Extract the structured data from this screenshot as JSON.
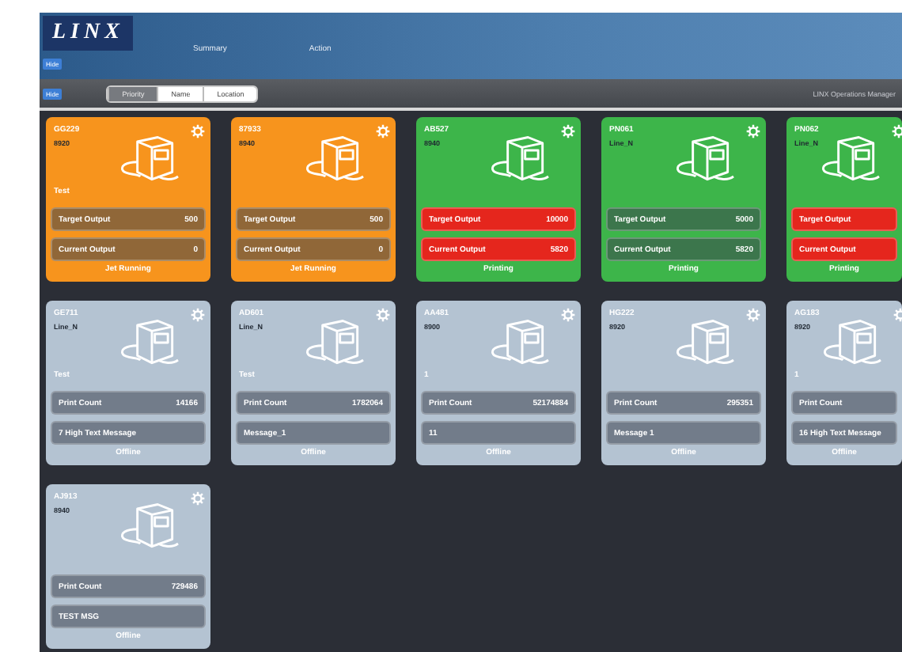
{
  "header": {
    "logo": "LINX",
    "badge": "Hide",
    "nav": [
      {
        "label": "Summary",
        "selected": false
      },
      {
        "label": "Action",
        "selected": false
      }
    ]
  },
  "toolbar": {
    "badge": "Hide",
    "sort": [
      {
        "label": "Priority",
        "selected": true
      },
      {
        "label": "Name",
        "selected": false
      },
      {
        "label": "Location",
        "selected": false
      }
    ],
    "app_name": "LINX Operations Manager"
  },
  "printers": [
    {
      "id": "GG229",
      "line": "8920",
      "color": "#f7941d",
      "message": "Test",
      "bars": [
        {
          "label": "Target Output",
          "value": "500",
          "alert": false
        },
        {
          "label": "Current Output",
          "value": "0",
          "alert": false
        }
      ],
      "status": "Jet Running"
    },
    {
      "id": "87933",
      "line": "8940",
      "color": "#f7941d",
      "bars": [
        {
          "label": "Target Output",
          "value": "500",
          "alert": false
        },
        {
          "label": "Current Output",
          "value": "0",
          "alert": false
        }
      ],
      "status": "Jet Running"
    },
    {
      "id": "AB527",
      "line": "8940",
      "color": "#3db54a",
      "bars": [
        {
          "label": "Target Output",
          "value": "10000",
          "alert": true
        },
        {
          "label": "Current Output",
          "value": "5820",
          "alert": true
        }
      ],
      "status": "Printing"
    },
    {
      "id": "PN061",
      "line": "Line_N",
      "color": "#3db54a",
      "bars": [
        {
          "label": "Target Output",
          "value": "5000",
          "alert": false
        },
        {
          "label": "Current Output",
          "value": "5820",
          "alert": false
        }
      ],
      "status": "Printing"
    },
    {
      "id": "PN062",
      "line": "Line_N",
      "color": "#3db54a",
      "bars": [
        {
          "label": "Target Output",
          "alert": true
        },
        {
          "label": "Current Output",
          "alert": true
        }
      ],
      "status": "Printing"
    },
    {
      "id": "GE711",
      "line": "Line_N",
      "color": "#b4c3d2",
      "message": "Test",
      "bars": [
        {
          "label": "Print Count",
          "value": "14166",
          "alert": false
        },
        {
          "label": "7 High Text Message",
          "alert": false
        }
      ],
      "status": "Offline"
    },
    {
      "id": "AD601",
      "line": "Line_N",
      "color": "#b4c3d2",
      "message": "Test",
      "bars": [
        {
          "label": "Print Count",
          "value": "1782064",
          "alert": false
        },
        {
          "label": "Message_1",
          "alert": false
        }
      ],
      "status": "Offline"
    },
    {
      "id": "AA481",
      "line": "8900",
      "color": "#b4c3d2",
      "message": "1",
      "bars": [
        {
          "label": "Print Count",
          "value": "52174884",
          "alert": false
        },
        {
          "label": "11",
          "alert": false
        }
      ],
      "status": "Offline"
    },
    {
      "id": "HG222",
      "line": "8920",
      "color": "#b4c3d2",
      "bars": [
        {
          "label": "Print Count",
          "value": "295351",
          "alert": false
        },
        {
          "label": "Message 1",
          "alert": false
        }
      ],
      "status": "Offline"
    },
    {
      "id": "AG183",
      "line": "8920",
      "color": "#b4c3d2",
      "message": "1",
      "bars": [
        {
          "label": "Print Count",
          "alert": false
        },
        {
          "label": "16 High Text Message",
          "alert": false
        }
      ],
      "status": "Offline"
    },
    {
      "id": "AJ913",
      "line": "8940",
      "color": "#b4c3d2",
      "bars": [
        {
          "label": "Print Count",
          "value": "729486",
          "alert": false
        },
        {
          "label": "TEST MSG",
          "alert": false
        }
      ],
      "status": "Offline"
    }
  ]
}
